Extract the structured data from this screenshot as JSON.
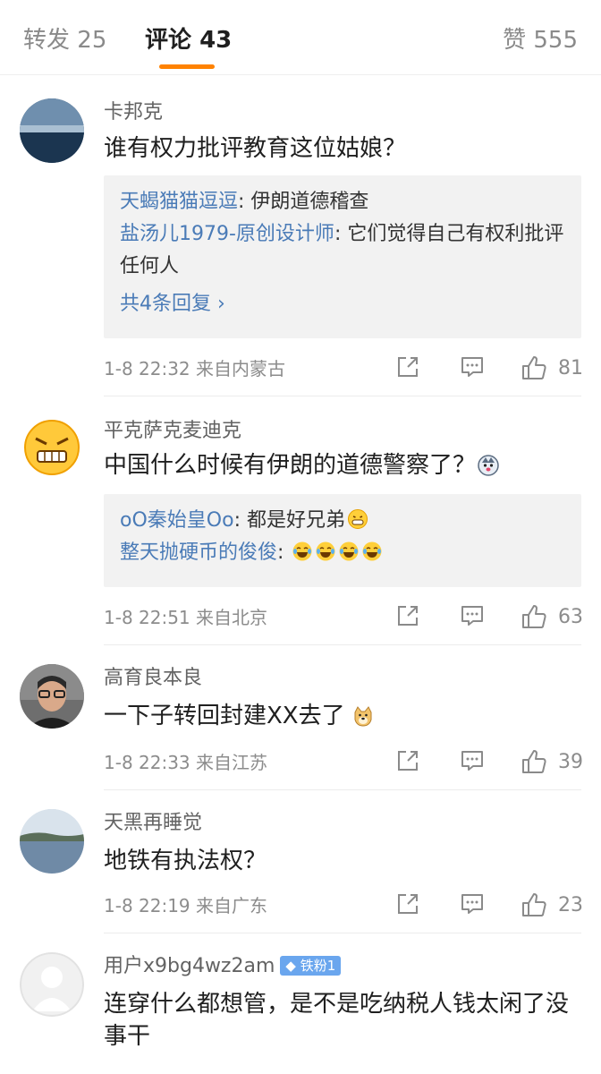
{
  "tabs": {
    "repost_label": "转发",
    "repost_count": "25",
    "comment_label": "评论",
    "comment_count": "43",
    "like_label": "赞",
    "like_count": "555"
  },
  "colors": {
    "accent": "#ff8200",
    "link": "#4a7bb7",
    "meta": "#8c8c8c"
  },
  "comments": [
    {
      "username": "卡邦克",
      "text": "谁有权力批评教育这位姑娘？",
      "replies": [
        {
          "name": "天蝎猫猫逗逗",
          "sep": ":",
          "text": " 伊朗道德稽查"
        },
        {
          "name": "盐汤儿1979-原创设计师",
          "sep": ":",
          "text": " 它们觉得自己有权利批评任何人"
        }
      ],
      "more_replies": "共4条回复 ›",
      "meta": "1-8 22:32  来自内蒙古",
      "likes": "81"
    },
    {
      "username": "平克萨克麦迪克",
      "text": "中国什么时候有伊朗的道德警察了？",
      "text_emoji": "husky-emoji",
      "replies": [
        {
          "name": "oO秦始皇Oo",
          "sep": ":",
          "text": " 都是好兄弟"
        },
        {
          "name": "整天抛硬币的俊俊",
          "sep": ":",
          "text": " "
        }
      ],
      "meta": "1-8 22:51  来自北京",
      "likes": "63"
    },
    {
      "username": "高育良本良",
      "text": "一下子转回封建XX去了",
      "text_emoji": "doge-emoji",
      "meta": "1-8 22:33  来自江苏",
      "likes": "39"
    },
    {
      "username": "天黑再睡觉",
      "text": "地铁有执法权？",
      "meta": "1-8 22:19  来自广东",
      "likes": "23"
    },
    {
      "username": "用户x9bg4wz2am",
      "badge": "铁粉1",
      "text": "连穿什么都想管，是不是吃纳税人钱太闲了没事干"
    }
  ]
}
